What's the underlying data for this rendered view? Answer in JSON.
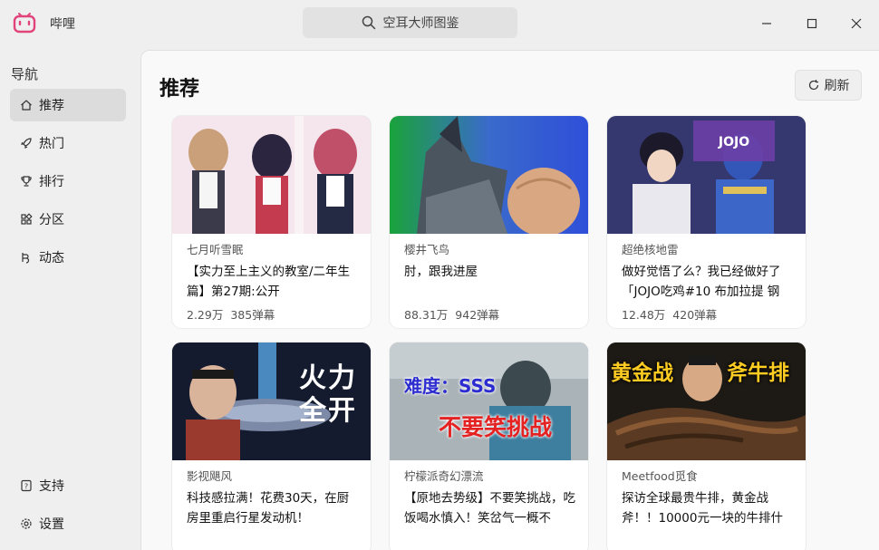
{
  "app": {
    "name": "哔哩"
  },
  "search": {
    "text": "空耳大师图鉴"
  },
  "sidebar": {
    "title": "导航",
    "items": [
      {
        "label": "推荐",
        "icon": "home-icon",
        "active": true
      },
      {
        "label": "热门",
        "icon": "rocket-icon"
      },
      {
        "label": "排行",
        "icon": "trophy-icon"
      },
      {
        "label": "分区",
        "icon": "grid-icon"
      },
      {
        "label": "动态",
        "icon": "activity-icon"
      }
    ],
    "bottom": [
      {
        "label": "支持",
        "icon": "help-icon"
      },
      {
        "label": "设置",
        "icon": "gear-icon"
      }
    ]
  },
  "main": {
    "title": "推荐",
    "refresh_label": "刷新"
  },
  "cards": [
    {
      "author": "七月听雪眠",
      "title": "【实力至上主义的教室/二年生篇】第27期:公开",
      "views": "2.29万",
      "danmaku": "385弹幕",
      "thumb": "anime-maids"
    },
    {
      "author": "樱井飞鸟",
      "title": "肘，跟我进屋",
      "views": "88.31万",
      "danmaku": "942弹幕",
      "thumb": "robot-arm"
    },
    {
      "author": "超绝核地雷",
      "title": "做好觉悟了么？我已经做好了「JOJO吃鸡#10 布加拉提 钢",
      "views": "12.48万",
      "danmaku": "420弹幕",
      "thumb": "jojo"
    },
    {
      "author": "影视飓风",
      "title": "科技感拉满！花费30天，在厨房里重启行星发动机！",
      "views": "",
      "danmaku": "",
      "thumb": "engine",
      "thumb_text": "火力全开"
    },
    {
      "author": "柠檬派奇幻漂流",
      "title": "【原地去势级】不要笑挑战，吃饭喝水慎入！笑岔气一概不",
      "views": "",
      "danmaku": "",
      "thumb": "challenge",
      "thumb_text_1": "难度：SSS",
      "thumb_text_2": "不要笑挑战"
    },
    {
      "author": "Meetfood觅食",
      "title": "探访全球最贵牛排，黄金战斧！！10000元一块的牛排什",
      "views": "",
      "danmaku": "",
      "thumb": "steak",
      "thumb_text_1": "黄金战",
      "thumb_text_2": "斧牛排"
    }
  ]
}
